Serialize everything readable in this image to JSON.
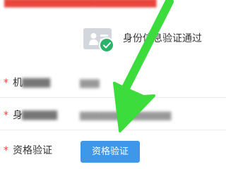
{
  "form": {
    "verification_status": "身份信息验证通过",
    "required_mark": "*",
    "qualification_label": "资格验证",
    "qualification_button": "资格验证"
  },
  "colors": {
    "required_red": "#e8453c",
    "button_blue": "#3e97e9",
    "success_green": "#2bb469",
    "annotation_arrow": "#3bdc3b"
  },
  "icons": {
    "id_card": "id-card-icon",
    "success": "check-circle-icon",
    "annotation": "arrow-down-left-icon"
  }
}
